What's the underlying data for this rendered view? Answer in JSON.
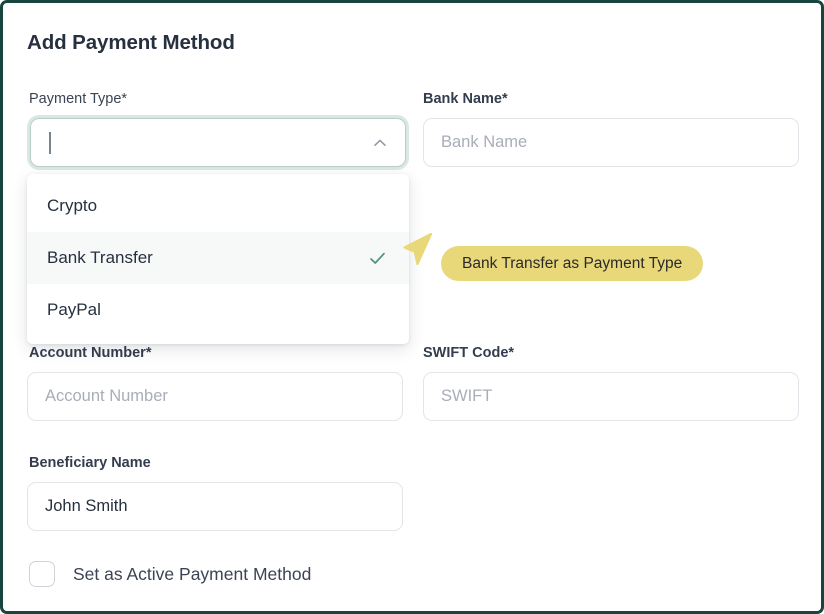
{
  "window": {
    "border_color": "#17453f",
    "background": "#ffffff"
  },
  "form": {
    "title": "Add Payment Method",
    "fields": {
      "payment_type": {
        "label": "Payment Type*",
        "value": "",
        "expanded": true,
        "chevron_icon": "chevron-up-icon"
      },
      "bank_name": {
        "label": "Bank Name*",
        "value": "",
        "placeholder": "Bank Name"
      },
      "account_number": {
        "label": "Account Number*",
        "value": "",
        "placeholder": "Account Number"
      },
      "swift_code": {
        "label": "SWIFT Code*",
        "value": "",
        "placeholder": "SWIFT"
      },
      "beneficiary_name": {
        "label": "Beneficiary Name",
        "value": "John Smith",
        "placeholder": ""
      }
    },
    "checkbox": {
      "label": "Set as Active Payment Method",
      "checked": false
    }
  },
  "dropdown": {
    "open": true,
    "options": [
      {
        "label": "Crypto",
        "selected": false
      },
      {
        "label": "Bank Transfer",
        "selected": true
      },
      {
        "label": "PayPal",
        "selected": false
      }
    ],
    "check_icon": "check-icon",
    "check_color": "#4f9180"
  },
  "annotation": {
    "tooltip_text": "Bank Transfer as Payment Type",
    "tooltip_bg": "#e8d87a",
    "cursor_icon": "cursor-arrow-icon",
    "cursor_color": "#e8d87a"
  },
  "colors": {
    "title": "#27303f",
    "label": "#3b4453",
    "placeholder": "#a8adb8",
    "input_border": "#e2e5ea",
    "focus_ring": "#dbe8e2",
    "focus_border": "#b9cfc6"
  }
}
